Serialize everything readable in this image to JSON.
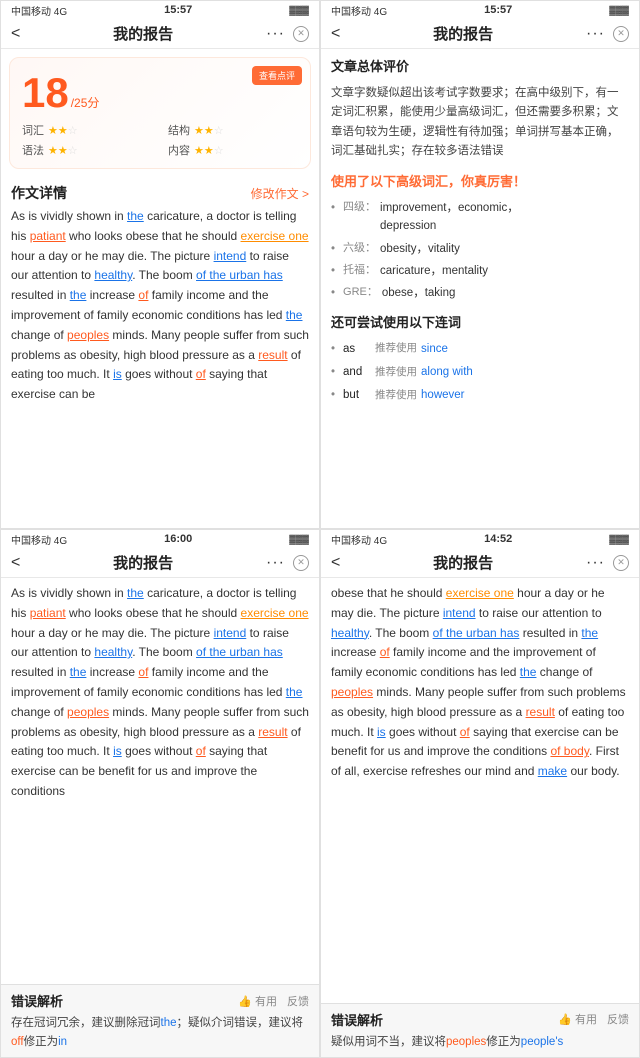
{
  "panels": {
    "topLeft": {
      "statusBar": {
        "carrier": "中国移动 4G",
        "time": "15:57",
        "battery": "▓▓▓▓"
      },
      "navTitle": "我的报告",
      "score": {
        "value": "18",
        "denom": "/25分",
        "reviewBtn": "查看点评"
      },
      "scoreItems": [
        {
          "label": "词汇",
          "stars": 2
        },
        {
          "label": "结构",
          "stars": 2
        },
        {
          "label": "语法",
          "stars": 2
        },
        {
          "label": "内容",
          "stars": 2
        }
      ],
      "sectionTitle": "作文详情",
      "sectionAction": "修改作文 >",
      "essay": "As is vividly shown in the caricature, a doctor is telling his patiant who looks obese that he should exercise one hour a day or he may die. The picture intend to raise our attention to healthy. The boom of the urban has resulted in the increase of family income and the improvement of family economic conditions has led the change of peoples minds. Many people suffer from such problems as obesity, high blood pressure as a result of eating too much. It is goes without of saying that exercise can be"
    },
    "topRight": {
      "statusBar": {
        "carrier": "中国移动 4G",
        "time": "15:57",
        "battery": "▓▓▓▓"
      },
      "navTitle": "我的报告",
      "overviewTitle": "文章总体评价",
      "overviewText": "文章字数疑似超出该考试字数要求；在高中级别下，有一定词汇积累，能使用少量高级词汇，但还需要多积累；文章语句较为生硬，逻辑性有待加强；单词拼写基本正确，词汇基础扎实；存在较多语法错误",
      "vocabTitle": "使用了以下高级词汇，你真厉害！",
      "vocabItems": [
        {
          "level": "四级：",
          "words": "improvement，economic，depression"
        },
        {
          "level": "六级：",
          "words": "obesity，vitality"
        },
        {
          "level": "托福：",
          "words": "caricature，mentality"
        },
        {
          "level": "GRE：",
          "words": "obese，taking"
        }
      ],
      "connectorTitle": "还可尝试使用以下连词",
      "connectorItems": [
        {
          "word": "as",
          "label": "推荐使用",
          "suggest": "since"
        },
        {
          "word": "and",
          "label": "推荐使用",
          "suggest": "along with"
        },
        {
          "word": "but",
          "label": "推荐使用",
          "suggest": "however"
        }
      ]
    },
    "bottomLeft": {
      "statusBar": {
        "carrier": "中国移动 4G",
        "time": "16:00",
        "battery": "▓▓▓▓"
      },
      "navTitle": "我的报告",
      "essay": "As is vividly shown in the caricature, a doctor is telling his patiant who looks obese that he should exercise one hour a day or he may die. The picture intend to raise our attention to healthy. The boom of the urban has resulted in the increase of family income and the improvement of family economic conditions has led the change of peoples minds. Many people suffer from such problems as obesity, high blood pressure as a result of eating too much. It is goes without of saying that exercise can be benefit for us and improve the conditions",
      "errorTitle": "错误解析",
      "errorActions": [
        "有用",
        "反馈"
      ],
      "errorText": "存在冠词冗余，建议删除冠词the；疑似介词错误，建议将off修正为in"
    },
    "bottomRight": {
      "statusBar": {
        "carrier": "中国移动 4G",
        "time": "14:52",
        "battery": "▓▓▓▓"
      },
      "navTitle": "我的报告",
      "essay": "obese that he should exercise one hour a day or he may die. The picture intend to raise our attention to healthy. The boom of the urban has resulted in the increase of family income and the improvement of family economic conditions has led the change of peoples minds. Many people suffer from such problems as obesity, high blood pressure as a result of eating too much. It is goes without of saying that exercise can be benefit for us and improve the conditions of body. First of all, exercise refreshes our mind and make our body.",
      "errorTitle": "错误解析",
      "errorActions": [
        "有用",
        "反馈"
      ],
      "errorText": "疑似用词不当，建议将peoples修正为people's"
    }
  }
}
